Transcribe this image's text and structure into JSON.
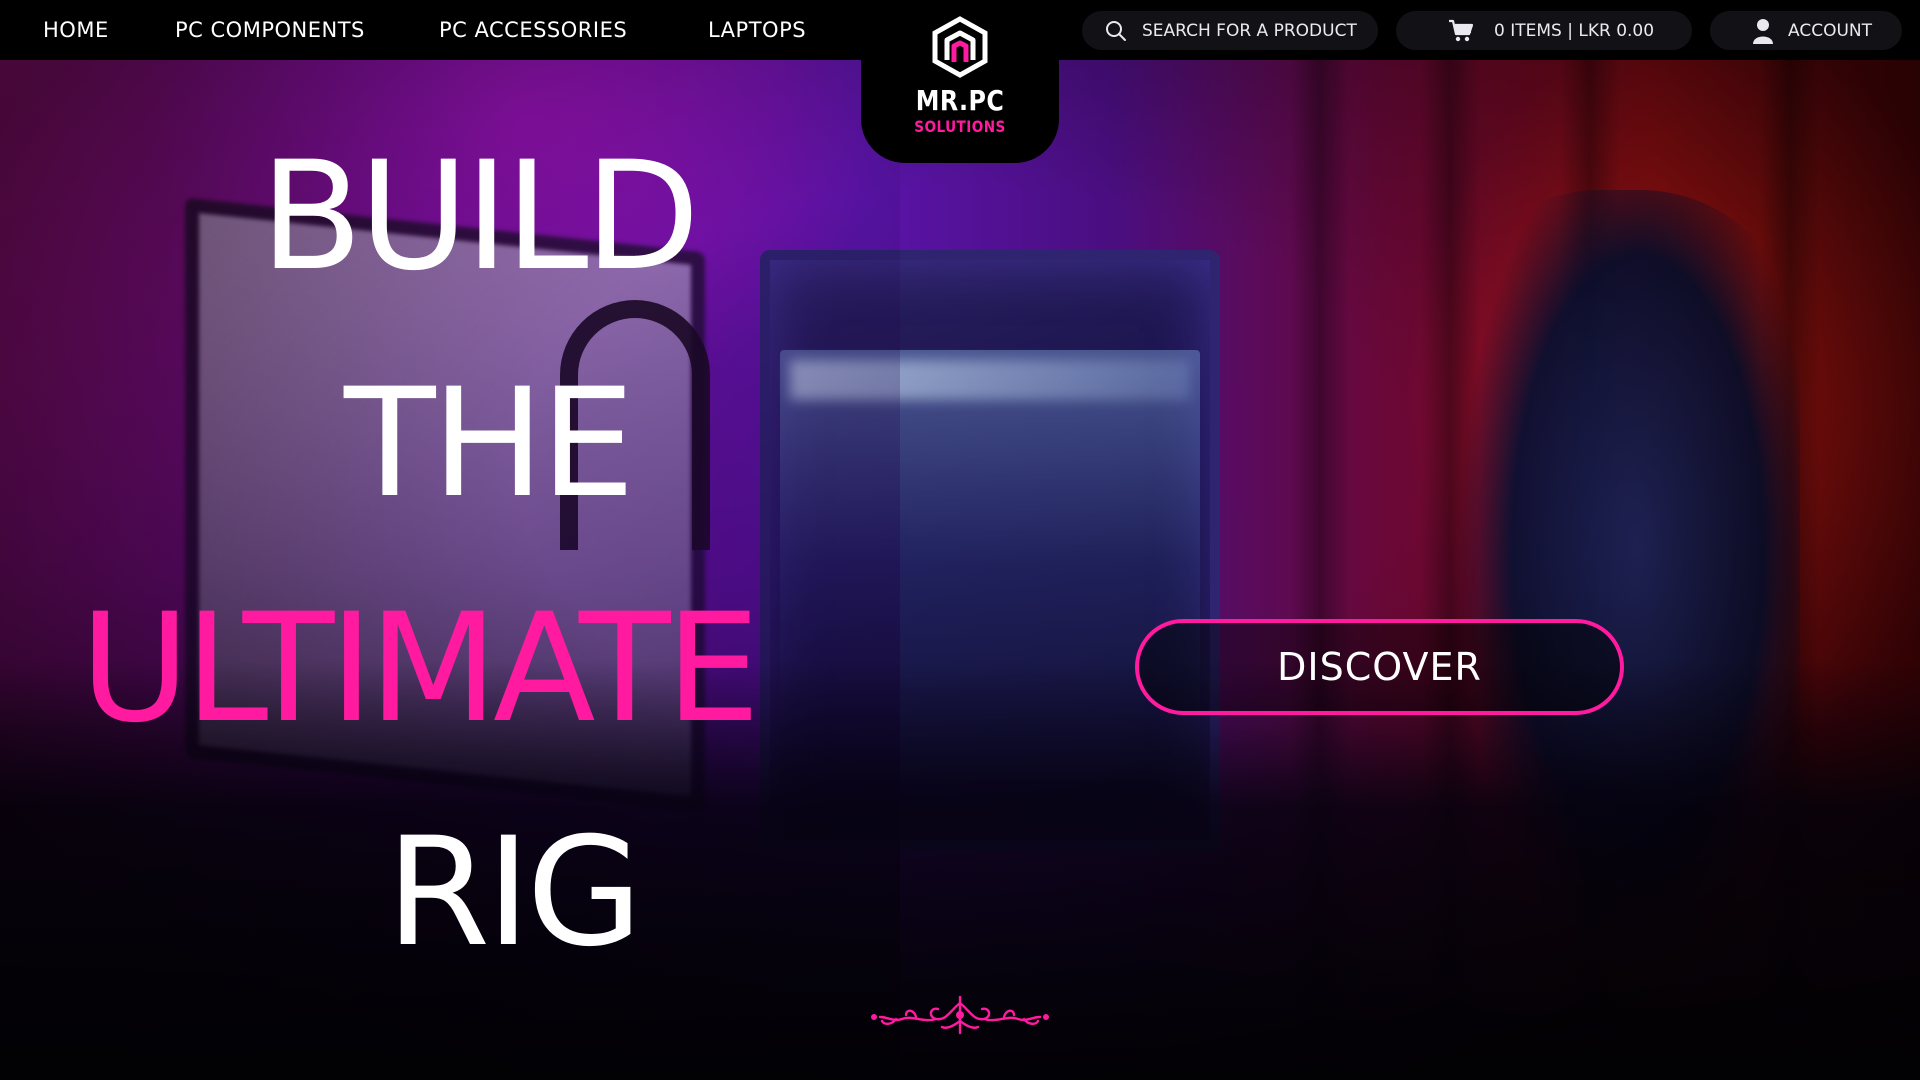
{
  "nav": {
    "items": [
      {
        "label": "HOME"
      },
      {
        "label": "PC COMPONENTS"
      },
      {
        "label": "PC ACCESSORIES"
      },
      {
        "label": "LAPTOPS"
      }
    ]
  },
  "logo": {
    "name": "MR.PC",
    "subtitle": "SOLUTIONS"
  },
  "search": {
    "placeholder": "SEARCH FOR A PRODUCT",
    "icon": "search-icon"
  },
  "cart": {
    "summary": "0 ITEMS | LKR 0.00",
    "icon": "cart-icon"
  },
  "account": {
    "label": "ACCOUNT",
    "icon": "user-icon"
  },
  "hero": {
    "line1": "BUILD",
    "line2": "THE",
    "line3": "ULTIMATE",
    "line4": "RIG",
    "cta_label": "DISCOVER"
  },
  "colors": {
    "accent": "#ff1aa0",
    "header_bg": "#000000",
    "pill_bg": "#121216",
    "text": "#ffffff"
  }
}
